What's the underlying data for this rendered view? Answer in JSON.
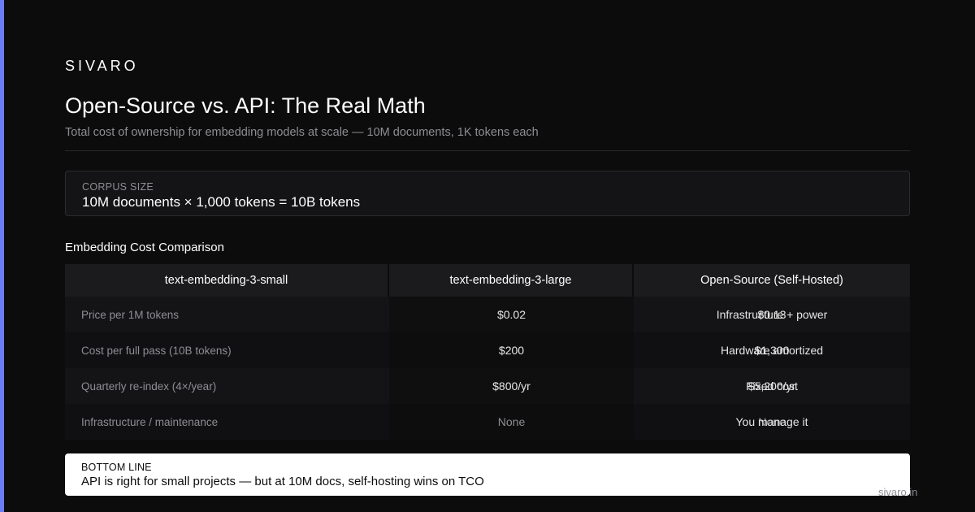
{
  "brand": "SIVARO",
  "title": "Open-Source vs. API: The Real Math",
  "subtitle": "Total cost of ownership for embedding models at scale — 10M documents, 1K tokens each",
  "corpus": {
    "label": "CORPUS SIZE",
    "value": "10M documents × 1,000 tokens = 10B tokens"
  },
  "section_title": "Embedding Cost Comparison",
  "table": {
    "headers": [
      "text-embedding-3-small",
      "text-embedding-3-large",
      "Open-Source (Self-Hosted)"
    ],
    "rows": [
      {
        "label": "Price per 1M tokens",
        "col2": "$0.02",
        "col3a": "$0.13",
        "col3b": "Infrastructure + power"
      },
      {
        "label": "Cost per full pass (10B tokens)",
        "col2": "$200",
        "col3a": "$1,300",
        "col3b": "Hardware amortized"
      },
      {
        "label": "Quarterly re-index (4×/year)",
        "col2": "$800/yr",
        "col3a": "$5,200/yr",
        "col3b": "Fixed cost"
      },
      {
        "label": "Infrastructure / maintenance",
        "col2": "None",
        "col3a": "None",
        "col3b": "You manage it"
      }
    ]
  },
  "bottom_line": {
    "label": "BOTTOM LINE",
    "value": "API is right for small projects — but at 10M docs, self-hosting wins on TCO"
  },
  "footer": "sivaro.in",
  "colors": {
    "accent": "#6b7cf5",
    "background": "#0c0c0d"
  }
}
